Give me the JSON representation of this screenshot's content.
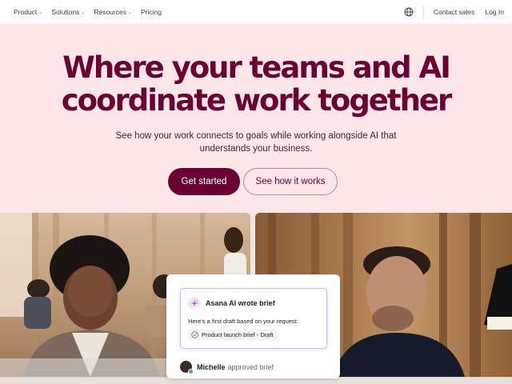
{
  "nav": {
    "items": [
      {
        "label": "Product",
        "chevron": "⌄"
      },
      {
        "label": "Solutions",
        "chevron": "⌄"
      },
      {
        "label": "Resources",
        "chevron": "⌄"
      },
      {
        "label": "Pricing"
      }
    ],
    "globe_icon": "globe-icon",
    "contact_label": "Contact sales",
    "login_label": "Log In"
  },
  "hero": {
    "headline_line1": "Where your teams and AI",
    "headline_line2": "coordinate work together",
    "subhead_line1": "See how your work connects to goals while working alongside AI that",
    "subhead_line2": "understands your business.",
    "primary_cta": "Get started",
    "secondary_cta": "See how it works",
    "background": "#fde6e7",
    "accent": "#690031"
  },
  "card": {
    "title": "Asana AI wrote brief",
    "message": "Here’s a first draft based on your request:",
    "draft_label": "Product launch brief - Draft",
    "approver": "Michelle",
    "approved_text": "approved brief"
  }
}
